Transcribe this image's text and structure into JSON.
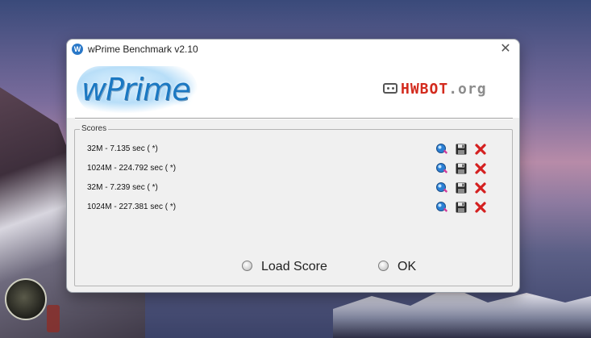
{
  "window": {
    "title": "wPrime Benchmark v2.10",
    "close_symbol": "✕"
  },
  "banner": {
    "logo_text": "wPrime",
    "hwbot_brand": "HWBOT",
    "hwbot_tld": ".org"
  },
  "scores": {
    "group_label": "Scores",
    "items": [
      {
        "text": "32M - 7.135 sec (  *)"
      },
      {
        "text": "1024M - 224.792 sec (  *)"
      },
      {
        "text": "32M - 7.239 sec (  *)"
      },
      {
        "text": "1024M - 227.381 sec (  *)"
      }
    ],
    "row_icons": [
      "view-icon",
      "save-icon",
      "delete-icon"
    ]
  },
  "options": {
    "load_score": "Load Score",
    "ok": "OK"
  },
  "colors": {
    "wprime_blue": "#1b78c2",
    "hwbot_red": "#d32b1e",
    "delete_red": "#d42020",
    "window_bg": "#f0f0f0"
  }
}
